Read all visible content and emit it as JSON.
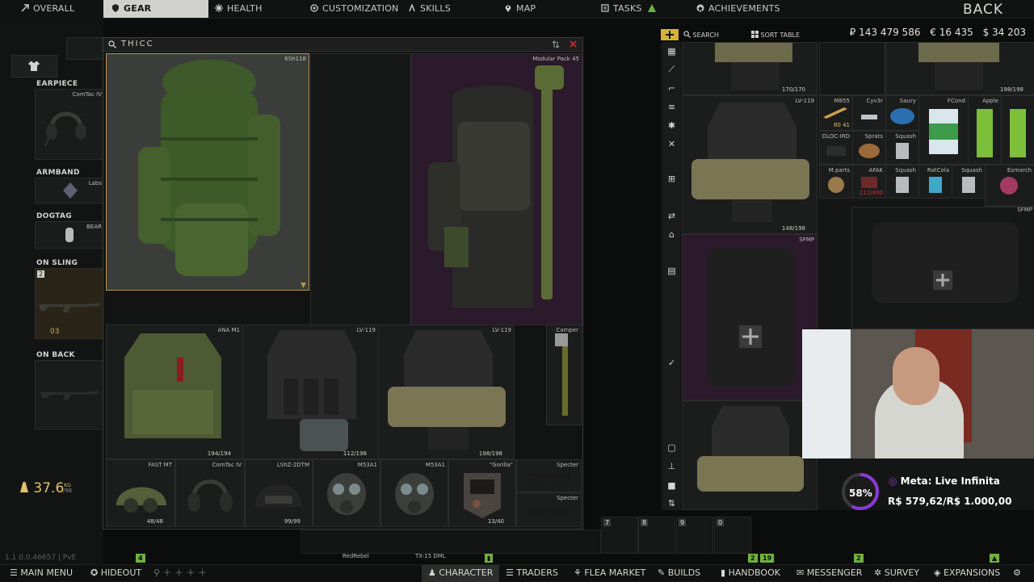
{
  "top_nav": {
    "items": [
      {
        "label": "OVERALL",
        "icon": "arrow-icon"
      },
      {
        "label": "GEAR",
        "icon": "shield-icon"
      },
      {
        "label": "HEALTH",
        "icon": "health-icon"
      },
      {
        "label": "CUSTOMIZATION",
        "icon": "customization-icon"
      },
      {
        "label": "SKILLS",
        "icon": "skills-icon"
      },
      {
        "label": "MAP",
        "icon": "map-pin-icon"
      },
      {
        "label": "TASKS",
        "icon": "tasks-icon"
      },
      {
        "label": "ACHIEVEMENTS",
        "icon": "achievements-icon"
      }
    ],
    "back_label": "BACK"
  },
  "left_panel": {
    "slots": [
      {
        "label": "EARPIECE",
        "item": "ComTac IV"
      },
      {
        "label": "ARMBAND",
        "item": "Labs"
      },
      {
        "label": "DOGTAG",
        "item": "BEAR"
      },
      {
        "label": "ON SLING",
        "badge": "2",
        "ammo": "03"
      },
      {
        "label": "ON BACK",
        "item": ""
      }
    ],
    "weight": "37.6",
    "weight_unit": "KG",
    "weight_max": "/98"
  },
  "stash_window": {
    "title": "THICC",
    "items": [
      {
        "name": "6Sh118",
        "count": ""
      },
      {
        "name": "Modular Pack 45",
        "count": ""
      },
      {
        "name": "ANA M1",
        "count": "194/194"
      },
      {
        "name": "LV-119",
        "count": "112/198"
      },
      {
        "name": "LV-119",
        "count": "198/198"
      },
      {
        "name": "Camper",
        "count": ""
      },
      {
        "name": "FAST MT",
        "count": "48/48"
      },
      {
        "name": "ComTac IV",
        "count": ""
      },
      {
        "name": "LShZ-2DTM",
        "count": "99/99"
      },
      {
        "name": "M53A1",
        "count": ""
      },
      {
        "name": "M53A1",
        "count": ""
      },
      {
        "name": "\"Gorilla\"",
        "count": "13/40"
      },
      {
        "name": "Specter",
        "count": ""
      },
      {
        "name": "Specter",
        "count": ""
      }
    ]
  },
  "right_inventory": {
    "search_label": "SEARCH",
    "sort_label": "SORT TABLE",
    "currency": {
      "rub": "₽ 143 479 586",
      "eur": "€ 16 435",
      "usd": "$ 34 203"
    },
    "items": [
      {
        "name": "",
        "count": "170/170"
      },
      {
        "name": "",
        "count": "198/198"
      },
      {
        "name": "LV-119",
        "count": "148/198"
      },
      {
        "name": "M855",
        "count": "80 41"
      },
      {
        "name": "Cyv3r",
        "count": ""
      },
      {
        "name": "Saury",
        "count": ""
      },
      {
        "name": "FCond",
        "count": ""
      },
      {
        "name": "Apple",
        "count": ""
      },
      {
        "name": "DLOC-IRD",
        "count": ""
      },
      {
        "name": "Sprats",
        "count": ""
      },
      {
        "name": "Squash",
        "count": ""
      },
      {
        "name": "M.parts",
        "count": ""
      },
      {
        "name": "AFAK",
        "count": "212/400"
      },
      {
        "name": "Squash",
        "count": ""
      },
      {
        "name": "RatCola",
        "count": ""
      },
      {
        "name": "Squash",
        "count": ""
      },
      {
        "name": "Esmarch",
        "count": ""
      },
      {
        "name": "SFMP",
        "count": ""
      },
      {
        "name": "SFMP",
        "count": ""
      }
    ]
  },
  "overlay": {
    "meta_label": "Meta: Live Infinita",
    "meta_progress": "58%",
    "meta_amount": "R$ 579,62/R$ 1.000,00"
  },
  "hotbar": {
    "slots": [
      "7",
      "8",
      "9",
      "0"
    ],
    "weapon_labels": [
      "RedRebel",
      "TX-15 DML"
    ]
  },
  "version": "1.1 0.0.46657 | PvE",
  "bottom_nav": {
    "items": [
      {
        "label": "MAIN MENU",
        "icon": "menu-icon"
      },
      {
        "label": "HIDEOUT",
        "icon": "hideout-icon"
      },
      {
        "label": "CHARACTER",
        "icon": "character-icon"
      },
      {
        "label": "TRADERS",
        "icon": "traders-icon"
      },
      {
        "label": "FLEA MARKET",
        "icon": "flea-icon"
      },
      {
        "label": "BUILDS",
        "icon": "builds-icon"
      },
      {
        "label": "HANDBOOK",
        "icon": "handbook-icon"
      },
      {
        "label": "MESSENGER",
        "icon": "messenger-icon"
      },
      {
        "label": "SURVEY",
        "icon": "survey-icon"
      },
      {
        "label": "EXPANSIONS",
        "icon": "expansions-icon"
      }
    ],
    "tags": [
      "4",
      "2",
      "19",
      "2"
    ]
  },
  "colors": {
    "accent_green": "#6db33f",
    "nav_active": "#d0d1cc",
    "meta_ring": "#8a3ad6",
    "backpack_purple": "#2b1a2b"
  }
}
